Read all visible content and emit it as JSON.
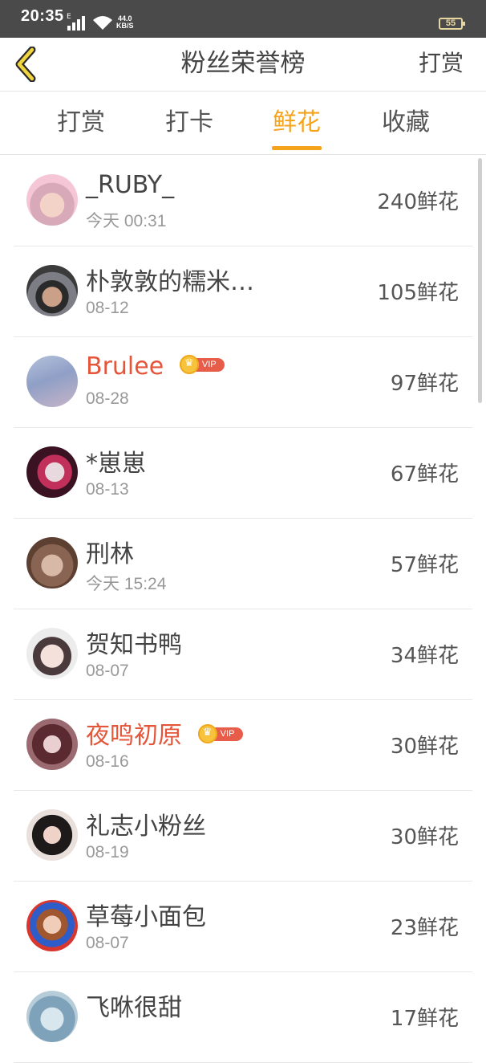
{
  "status_bar": {
    "time": "20:35",
    "network_label": "E",
    "speed_value": "44.0",
    "speed_unit": "KB/S",
    "battery": "55"
  },
  "header": {
    "title": "粉丝荣誉榜",
    "right_action": "打赏",
    "back_icon": "chevron-left-icon"
  },
  "tabs": [
    {
      "label": "打赏",
      "active": false
    },
    {
      "label": "打卡",
      "active": false
    },
    {
      "label": "鲜花",
      "active": true
    },
    {
      "label": "收藏",
      "active": false
    }
  ],
  "colors": {
    "accent": "#f5a31a",
    "vip_name": "#e4553a",
    "status_bar": "#4a4a4a"
  },
  "fans": [
    {
      "name": "_RUBY_",
      "date": "今天 00:31",
      "score": "240鲜花",
      "vip": false,
      "vip_label": ""
    },
    {
      "name": "朴敦敦的糯米…",
      "date": "08-12",
      "score": "105鲜花",
      "vip": false,
      "vip_label": ""
    },
    {
      "name": "Brulee",
      "date": "08-28",
      "score": "97鲜花",
      "vip": true,
      "vip_label": "VIP"
    },
    {
      "name": "*崽崽",
      "date": "08-13",
      "score": "67鲜花",
      "vip": false,
      "vip_label": ""
    },
    {
      "name": "刑林",
      "date": "今天 15:24",
      "score": "57鲜花",
      "vip": false,
      "vip_label": ""
    },
    {
      "name": "贺知书鸭",
      "date": "08-07",
      "score": "34鲜花",
      "vip": false,
      "vip_label": ""
    },
    {
      "name": "夜鸣初原",
      "date": "08-16",
      "score": "30鲜花",
      "vip": true,
      "vip_label": "VIP"
    },
    {
      "name": "礼志小粉丝",
      "date": "08-19",
      "score": "30鲜花",
      "vip": false,
      "vip_label": ""
    },
    {
      "name": "草莓小面包",
      "date": "08-07",
      "score": "23鲜花",
      "vip": false,
      "vip_label": ""
    },
    {
      "name": "飞咻很甜",
      "date": "",
      "score": "17鲜花",
      "vip": false,
      "vip_label": ""
    }
  ]
}
